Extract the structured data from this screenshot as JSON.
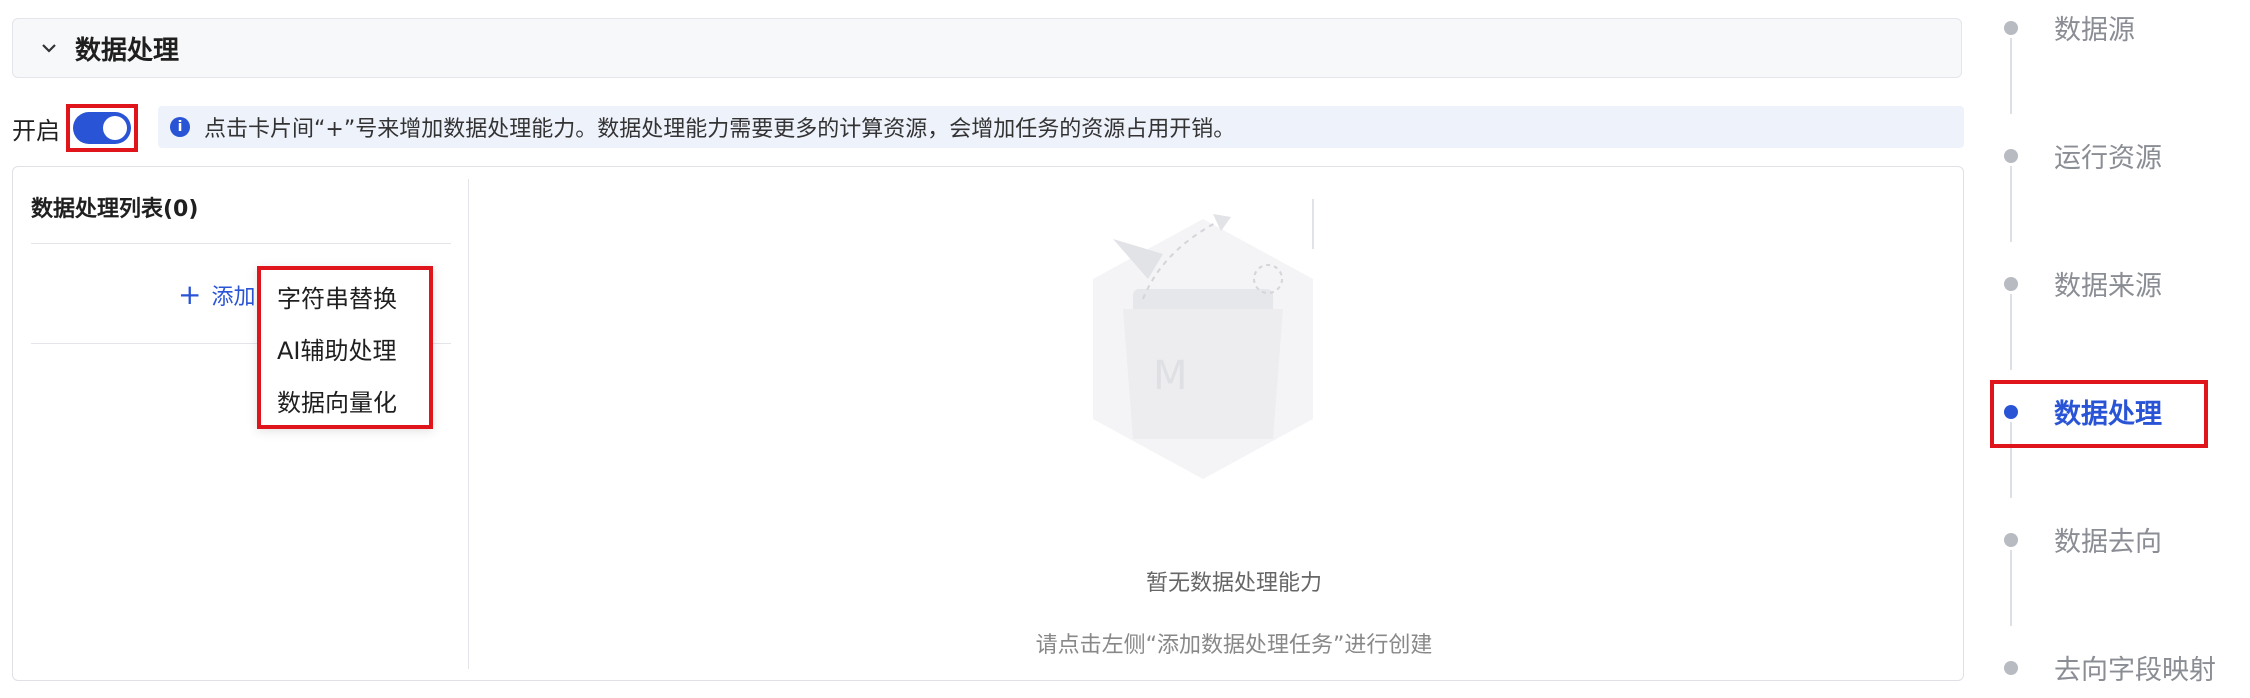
{
  "section": {
    "title": "数据处理",
    "chevron_icon": "chevron-down-icon"
  },
  "enable": {
    "label": "开启",
    "toggle_on": true
  },
  "info": {
    "icon": "info-icon",
    "text": "点击卡片间“+”号来增加数据处理能力。数据处理能力需要更多的计算资源，会增加任务的资源占用开销。"
  },
  "list": {
    "title": "数据处理列表(0)",
    "add_label": "添加"
  },
  "dropdown": {
    "items": [
      "字符串替换",
      "AI辅助处理",
      "数据向量化"
    ]
  },
  "empty": {
    "title": "暂无数据处理能力",
    "hint": "请点击左侧“添加数据处理任务”进行创建"
  },
  "steps": [
    {
      "label": "数据源",
      "active": false
    },
    {
      "label": "运行资源",
      "active": false
    },
    {
      "label": "数据来源",
      "active": false
    },
    {
      "label": "数据处理",
      "active": true
    },
    {
      "label": "数据去向",
      "active": false
    },
    {
      "label": "去向字段映射",
      "active": false
    }
  ],
  "colors": {
    "accent": "#2a54d6",
    "highlight_border": "#e0141b",
    "info_bg": "#eef2fb"
  }
}
